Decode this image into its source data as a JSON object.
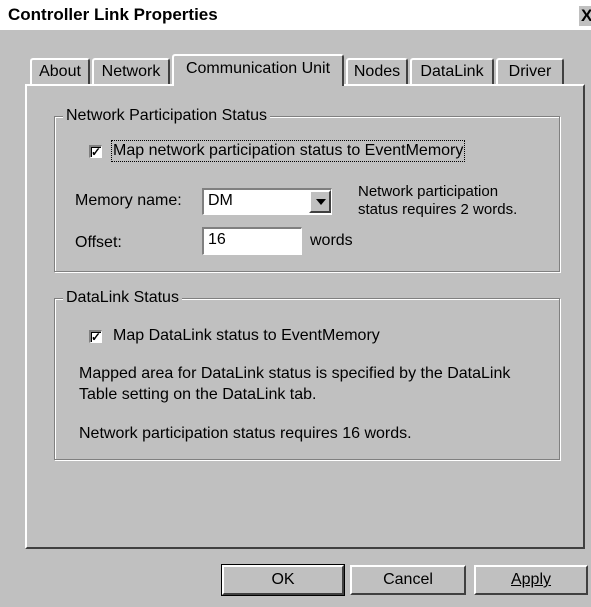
{
  "window": {
    "title": "Controller Link Properties",
    "close_glyph": "X"
  },
  "tabs": [
    {
      "label": "About"
    },
    {
      "label": "Network"
    },
    {
      "label": "Communication Unit",
      "active": true
    },
    {
      "label": "Nodes"
    },
    {
      "label": "DataLink"
    },
    {
      "label": "Driver"
    }
  ],
  "network_group": {
    "legend": "Network Participation Status",
    "map_checkbox": {
      "checked": true,
      "label": "Map network participation status to EventMemory"
    },
    "memory_name_label": "Memory name:",
    "memory_name_value": "DM",
    "offset_label": "Offset:",
    "offset_value": "16",
    "offset_unit": "words",
    "note_line1": "Network participation",
    "note_line2": "status requires 2 words."
  },
  "datalink_group": {
    "legend": "DataLink Status",
    "map_checkbox": {
      "checked": true,
      "label": "Map DataLink status to EventMemory"
    },
    "desc_line1": "Mapped area for DataLink status is specified by the DataLink",
    "desc_line2": "Table setting on the DataLink tab.",
    "requirement": "Network participation status requires 16 words."
  },
  "buttons": {
    "ok": "OK",
    "cancel": "Cancel",
    "apply": "Apply"
  },
  "icons": {
    "checkmark": "check-icon",
    "dropdown": "chevron-down-icon",
    "close": "close-icon"
  }
}
